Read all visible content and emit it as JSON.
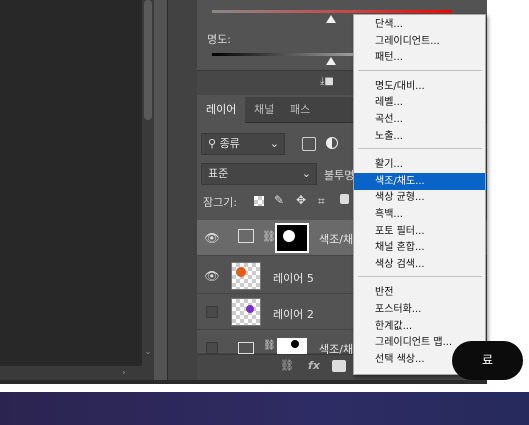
{
  "properties": {
    "lightness_label": "명도:",
    "saturation_value": "",
    "lightness_value": ""
  },
  "tabs": [
    {
      "label": "레이어"
    },
    {
      "label": "채널"
    },
    {
      "label": "패스"
    }
  ],
  "layers_panel": {
    "filter_kind": "종류",
    "blend_mode": "표준",
    "opacity_label": "불투명",
    "lock_label": "잠그기:"
  },
  "layers": [
    {
      "name": "색조/채",
      "visible": true,
      "type": "adjustment"
    },
    {
      "name": "레이어 5",
      "visible": true,
      "type": "pixel"
    },
    {
      "name": "레이어 2",
      "visible": false,
      "type": "pixel"
    },
    {
      "name": "색조/채",
      "visible": false,
      "type": "adjustment"
    }
  ],
  "menu": {
    "groups": [
      [
        "단색...",
        "그레이디언트...",
        "패턴..."
      ],
      [
        "명도/대비...",
        "레벨...",
        "곡선...",
        "노출..."
      ],
      [
        "활기...",
        "색조/채도...",
        "색상 균형...",
        "흑백...",
        "포토 필터...",
        "채널 혼합...",
        "색상 검색..."
      ],
      [
        "반전",
        "포스터화...",
        "한계값...",
        "그레이디언트 맵...",
        "선택 색상..."
      ]
    ],
    "highlighted": "색조/채도..."
  },
  "footer": {
    "fx_label": "fx"
  },
  "pill_button": {
    "label": "료"
  },
  "colors": {
    "menu_highlight": "#0a64c8",
    "panel_bg": "#535353"
  }
}
